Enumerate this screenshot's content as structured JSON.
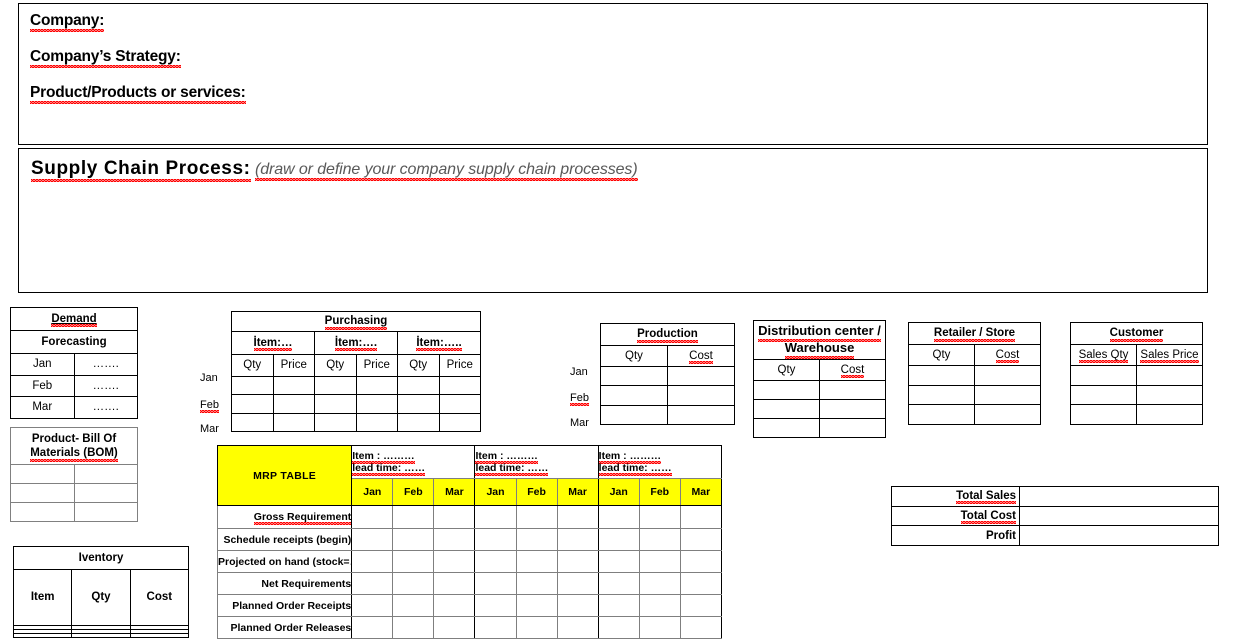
{
  "document": {
    "type": "supply-chain-project-worksheet"
  },
  "header_box": {
    "lines": [
      {
        "label": "Company:"
      },
      {
        "label": "Company’s Strategy:"
      },
      {
        "label": "Product/Products or services:"
      }
    ]
  },
  "supply_chain_box": {
    "title": "Supply Chain Process:",
    "hint": "(draw or define your company supply chain processes)"
  },
  "demand": {
    "title": "Demand",
    "subtitle": "Forecasting",
    "rows": [
      {
        "month": "Jan",
        "value": "……."
      },
      {
        "month": "Feb",
        "value": "……."
      },
      {
        "month": "Mar",
        "value": "……."
      }
    ]
  },
  "bom": {
    "title_line1": "Product- Bill Of",
    "title_line2": "Materials (BOM)",
    "rows": [
      [
        "",
        ""
      ],
      [
        "",
        ""
      ],
      [
        "",
        ""
      ]
    ]
  },
  "inventory": {
    "title": "Iventory",
    "columns": [
      "Item",
      "Qty",
      "Cost"
    ],
    "rows": [
      [
        "",
        "",
        ""
      ],
      [
        "",
        "",
        ""
      ],
      [
        "",
        "",
        ""
      ]
    ]
  },
  "purchasing": {
    "title": "Purchasing",
    "item_headers": [
      "İtem:…",
      "İtem:….",
      "İtem:….."
    ],
    "sub_columns": [
      "Qty",
      "Price"
    ],
    "month_labels": [
      "Jan",
      "Feb",
      "Mar"
    ],
    "rows": [
      [
        "",
        "",
        "",
        "",
        "",
        ""
      ],
      [
        "",
        "",
        "",
        "",
        "",
        ""
      ],
      [
        "",
        "",
        "",
        "",
        "",
        ""
      ]
    ]
  },
  "production": {
    "title": "Production",
    "columns": [
      "Qty",
      "Cost"
    ],
    "month_labels": [
      "Jan",
      "Feb",
      "Mar"
    ],
    "rows": [
      [
        "",
        ""
      ],
      [
        "",
        ""
      ],
      [
        "",
        ""
      ]
    ]
  },
  "distribution": {
    "title_line1": "Distribution center /",
    "title_line2": "Warehouse",
    "columns": [
      "Qty",
      "Cost"
    ],
    "rows": [
      [
        "",
        ""
      ],
      [
        "",
        ""
      ],
      [
        "",
        ""
      ]
    ]
  },
  "retailer": {
    "title": "Retailer / Store",
    "columns": [
      "Qty",
      "Cost"
    ],
    "rows": [
      [
        "",
        ""
      ],
      [
        "",
        ""
      ],
      [
        "",
        ""
      ]
    ]
  },
  "customer": {
    "title": "Customer",
    "columns": [
      "Sales Qty",
      "Sales Price"
    ],
    "rows": [
      [
        "",
        ""
      ],
      [
        "",
        ""
      ],
      [
        "",
        ""
      ]
    ]
  },
  "mrp": {
    "brand": "MRP TABLE",
    "item_groups": [
      {
        "item_line": "Item : ………",
        "lead_time_line": "lead time: ……"
      },
      {
        "item_line": "Item : ………",
        "lead_time_line": "lead time: ……"
      },
      {
        "item_line": "Item : ………",
        "lead_time_line": "lead time: ……"
      }
    ],
    "months": [
      "Jan",
      "Feb",
      "Mar"
    ],
    "row_labels": [
      "Gross Requirement",
      "Schedule receipts (begin)",
      "Projected on hand (stock=….)",
      "Net Requirements",
      "Planned Order Receipts",
      "Planned Order Releases"
    ],
    "cells": [
      [
        "",
        "",
        "",
        "",
        "",
        "",
        "",
        "",
        ""
      ],
      [
        "",
        "",
        "",
        "",
        "",
        "",
        "",
        "",
        ""
      ],
      [
        "",
        "",
        "",
        "",
        "",
        "",
        "",
        "",
        ""
      ],
      [
        "",
        "",
        "",
        "",
        "",
        "",
        "",
        "",
        ""
      ],
      [
        "",
        "",
        "",
        "",
        "",
        "",
        "",
        "",
        ""
      ],
      [
        "",
        "",
        "",
        "",
        "",
        "",
        "",
        "",
        ""
      ]
    ]
  },
  "totals": {
    "rows": [
      {
        "label": "Total Sales",
        "value": ""
      },
      {
        "label": "Total Cost",
        "value": ""
      },
      {
        "label": "Profit",
        "value": ""
      }
    ]
  },
  "colors": {
    "highlight": "#FFFF00",
    "border": "#000000",
    "soft_border": "#808080",
    "hint_text": "#595959",
    "spellcheck": "#FF0000"
  }
}
